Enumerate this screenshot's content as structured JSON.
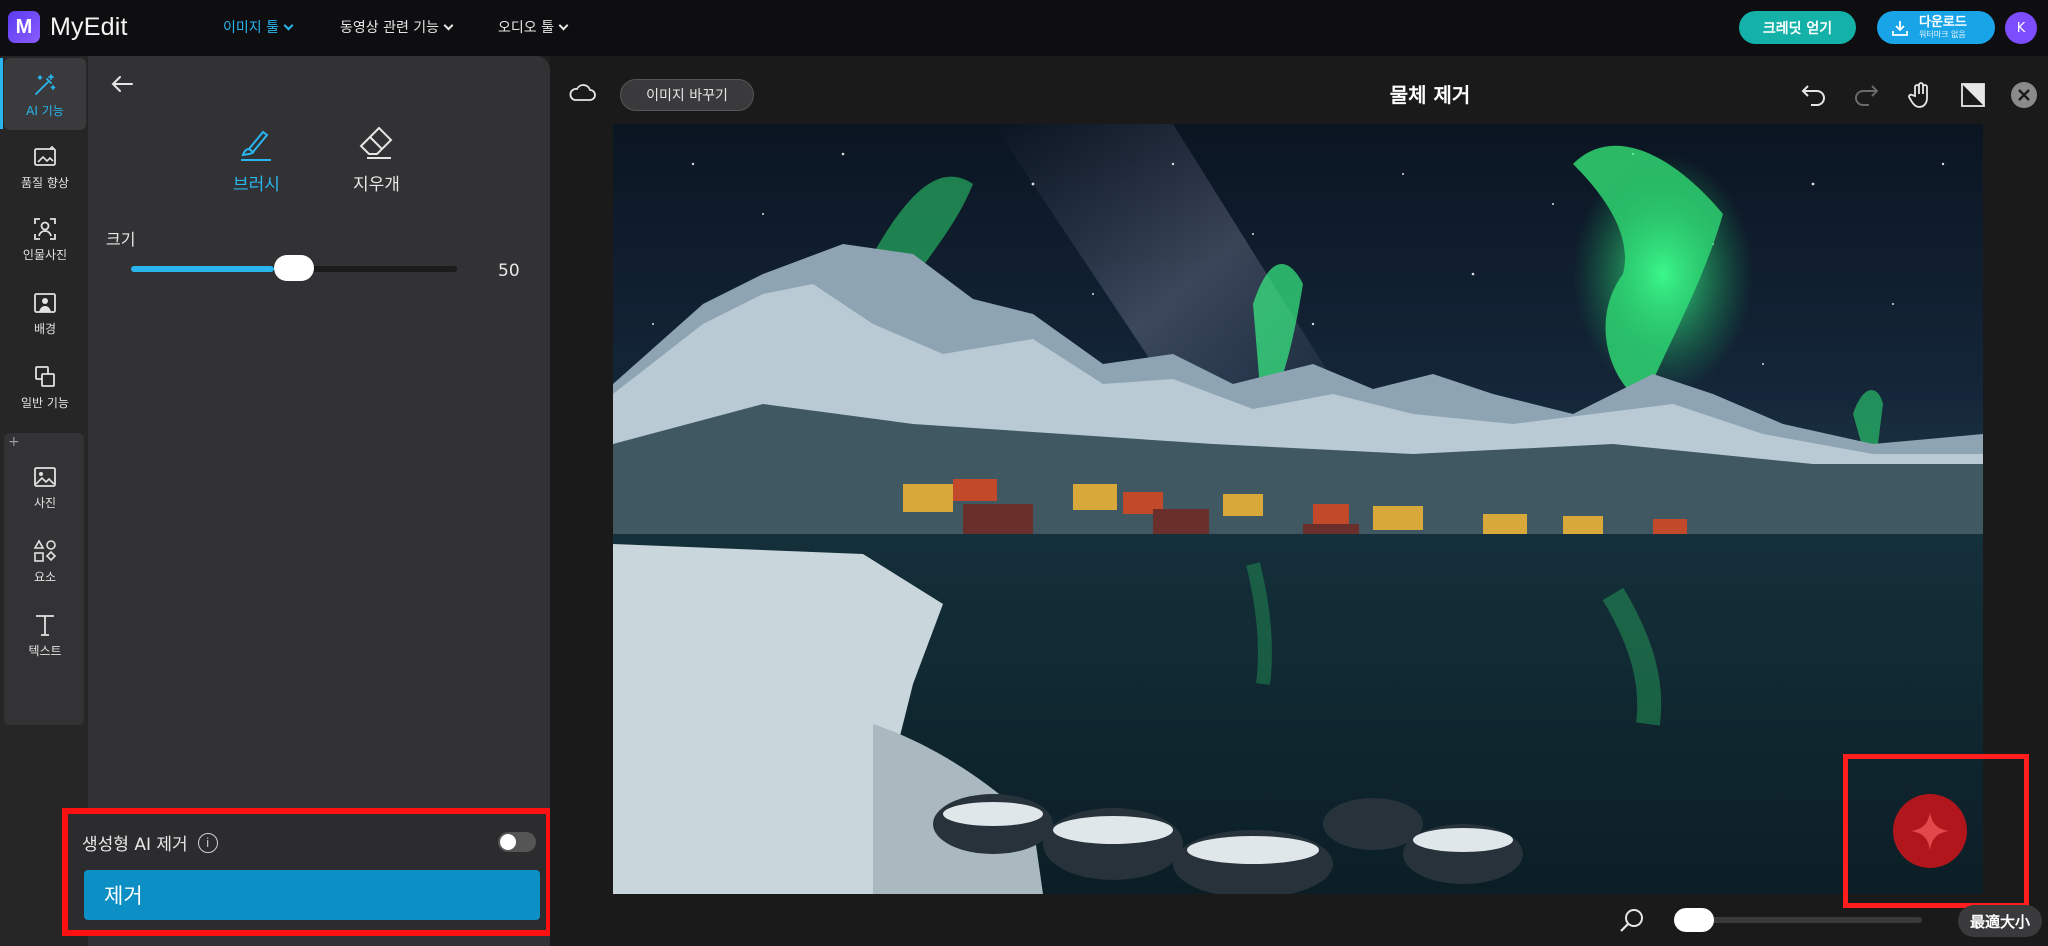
{
  "app": {
    "name": "MyEdit",
    "logo_letter": "M"
  },
  "nav": [
    {
      "label": "이미지 툴",
      "active": true
    },
    {
      "label": "동영상 관련 기능",
      "active": false
    },
    {
      "label": "오디오 툴",
      "active": false
    }
  ],
  "header": {
    "credit_label": "크레딧 얻기",
    "download_label": "다운로드",
    "download_sub": "워터마크 없음",
    "avatar_initial": "K"
  },
  "rail": {
    "items": [
      {
        "label": "AI 기능",
        "icon": "magic-wand-icon"
      },
      {
        "label": "품질 향상",
        "icon": "enhance-icon"
      },
      {
        "label": "인물사진",
        "icon": "portrait-icon"
      },
      {
        "label": "배경",
        "icon": "background-icon"
      },
      {
        "label": "일반 기능",
        "icon": "layers-icon"
      }
    ],
    "add_items": [
      {
        "label": "사진",
        "icon": "photo-icon"
      },
      {
        "label": "요소",
        "icon": "shapes-icon"
      },
      {
        "label": "텍스트",
        "icon": "text-icon"
      }
    ],
    "plus": "+"
  },
  "panel": {
    "tools": [
      {
        "label": "브러시",
        "icon": "brush-icon",
        "active": true
      },
      {
        "label": "지우개",
        "icon": "eraser-icon",
        "active": false
      }
    ],
    "size_label": "크기",
    "size_value": "50",
    "size_fraction": 0.5,
    "gen_ai_label": "생성형 AI 제거",
    "gen_ai_enabled": false,
    "remove_label": "제거"
  },
  "canvas": {
    "replace_label": "이미지 바꾸기",
    "title": "물체 제거",
    "fit_label": "最適大小",
    "zoom_fraction": 0.0
  },
  "colors": {
    "accent": "#29b6ef",
    "credit": "#14b1a8",
    "download": "#1aa4e8",
    "highlight": "#ff1010",
    "sparkle": "#b0161c"
  }
}
